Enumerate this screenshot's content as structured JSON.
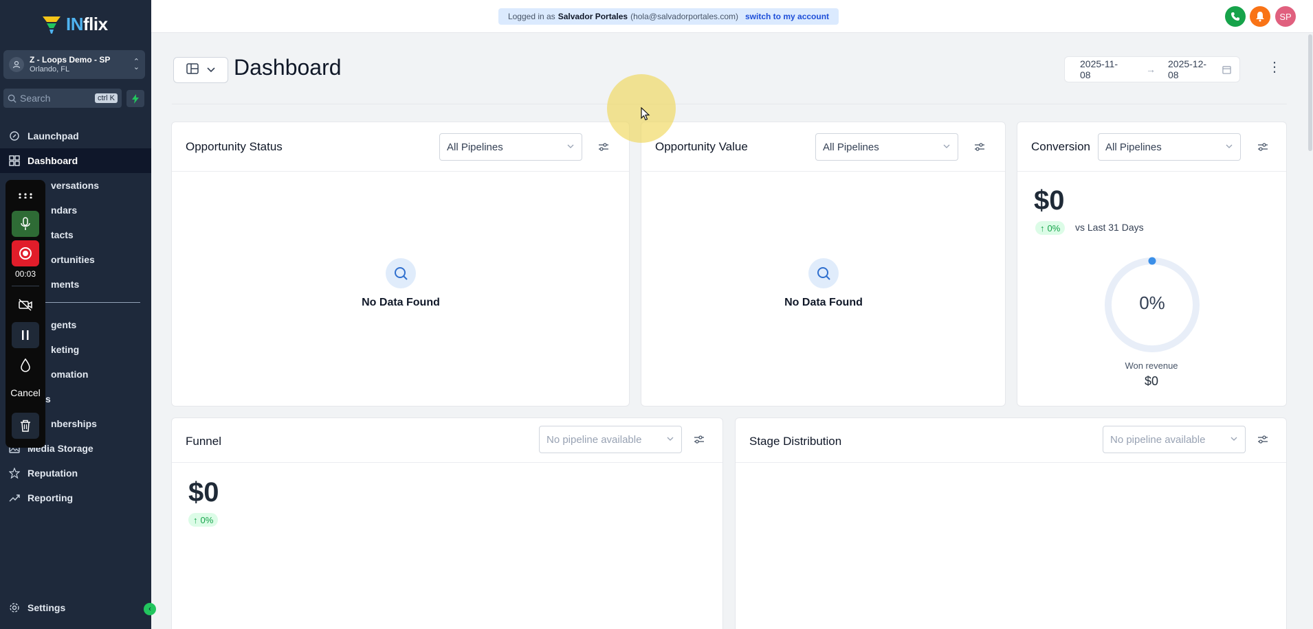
{
  "app": {
    "logo_prefix": "IN",
    "logo_suffix": "flix"
  },
  "account": {
    "name": "Z - Loops Demo - SP",
    "location": "Orlando, FL"
  },
  "search": {
    "placeholder": "Search",
    "shortcut": "ctrl K"
  },
  "sidebar": {
    "items": [
      {
        "label": "Launchpad",
        "icon": "rocket-icon"
      },
      {
        "label": "Dashboard",
        "icon": "grid-icon",
        "active": true
      },
      {
        "label": "Conversations",
        "visible_fragment": "versations",
        "icon": "chat-icon"
      },
      {
        "label": "Calendars",
        "visible_fragment": "ndars",
        "icon": "calendar-icon"
      },
      {
        "label": "Contacts",
        "visible_fragment": "tacts",
        "icon": "contacts-icon"
      },
      {
        "label": "Opportunities",
        "visible_fragment": "ortunities",
        "icon": "funnel-icon"
      },
      {
        "label": "Payments",
        "visible_fragment": "ments",
        "icon": "payments-icon"
      },
      {
        "label": "AI Agents",
        "visible_fragment": "gents",
        "icon": "robot-icon"
      },
      {
        "label": "Marketing",
        "visible_fragment": "keting",
        "icon": "megaphone-icon"
      },
      {
        "label": "Automation",
        "visible_fragment": "omation",
        "icon": "automation-icon"
      },
      {
        "label": "Sites",
        "visible_fragment": "s",
        "icon": "globe-icon"
      },
      {
        "label": "Memberships",
        "visible_fragment": "nberships",
        "icon": "membership-icon"
      },
      {
        "label": "Media Storage",
        "icon": "image-icon"
      },
      {
        "label": "Reputation",
        "icon": "star-icon"
      },
      {
        "label": "Reporting",
        "icon": "trend-icon"
      }
    ],
    "settings_label": "Settings"
  },
  "recorder": {
    "time": "00:03",
    "cancel_label": "Cancel"
  },
  "topbar": {
    "logged_in_prefix": "Logged in as",
    "user_name": "Salvador Portales",
    "user_email": "(hola@salvadorportales.com)",
    "switch_label": "switch to my account",
    "avatar_initials": "SP"
  },
  "page": {
    "title": "Dashboard",
    "date_from": "2025-11-08",
    "date_to": "2025-12-08"
  },
  "cards": {
    "opportunity_status": {
      "title": "Opportunity Status",
      "select": "All Pipelines",
      "empty": "No Data Found"
    },
    "opportunity_value": {
      "title": "Opportunity Value",
      "select": "All Pipelines",
      "empty": "No Data Found"
    },
    "conversion": {
      "title": "Conversion",
      "select": "All Pipelines",
      "value": "$0",
      "change": "0%",
      "change_suffix": "vs Last 31 Days",
      "donut_pct": "0%",
      "donut_fraction": 0,
      "won_label": "Won revenue",
      "won_value": "$0"
    },
    "funnel": {
      "title": "Funnel",
      "select": "No pipeline available",
      "value": "$0",
      "change": "0%"
    },
    "stage_distribution": {
      "title": "Stage Distribution",
      "select": "No pipeline available"
    }
  },
  "colors": {
    "sidebar_bg": "#1e293b",
    "accent_green": "#16a34a",
    "accent_blue": "#2f6fce",
    "record_red": "#e11d2a"
  }
}
